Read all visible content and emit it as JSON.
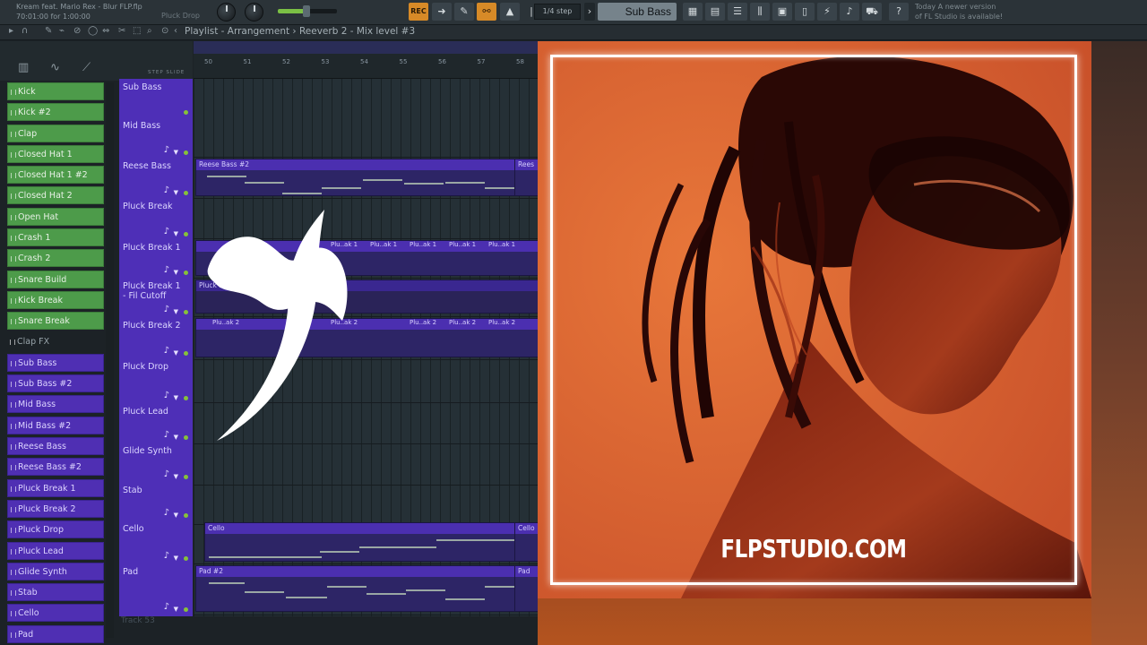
{
  "header": {
    "song_title": "Kream feat. Mario Rex - Blur FLP.flp",
    "song_time": "70:01:00 for 1:00:00",
    "pattern_hint": "Pluck Drop",
    "record_label": "REC",
    "step_size": "1/4 step",
    "selected_channel": "Sub Bass",
    "update_line1": "Today  A newer version",
    "update_line2": "of FL Studio is available!"
  },
  "playlist": {
    "title": "Playlist - Arrangement  ›  Reeverb 2 - Mix level #3",
    "step_slide": "STEP  SLIDE",
    "bars": [
      "50",
      "51",
      "52",
      "53",
      "54",
      "55",
      "56",
      "57",
      "58"
    ],
    "track_footer": "Track 53"
  },
  "channel_rack": [
    {
      "label": "Kick",
      "color": "green"
    },
    {
      "label": "Kick #2",
      "color": "green"
    },
    {
      "label": "Clap",
      "color": "green"
    },
    {
      "label": "Closed Hat 1",
      "color": "green"
    },
    {
      "label": "Closed Hat 1 #2",
      "color": "green"
    },
    {
      "label": "Closed Hat 2",
      "color": "green"
    },
    {
      "label": "Open Hat",
      "color": "green"
    },
    {
      "label": "Crash 1",
      "color": "green"
    },
    {
      "label": "Crash 2",
      "color": "green"
    },
    {
      "label": "Snare Build",
      "color": "green"
    },
    {
      "label": "Kick Break",
      "color": "green"
    },
    {
      "label": "Snare Break",
      "color": "green"
    },
    {
      "label": "Clap FX",
      "color": "none"
    },
    {
      "label": "Sub Bass",
      "color": "purple"
    },
    {
      "label": "Sub Bass #2",
      "color": "purple"
    },
    {
      "label": "Mid Bass",
      "color": "purple"
    },
    {
      "label": "Mid Bass #2",
      "color": "purple"
    },
    {
      "label": "Reese Bass",
      "color": "purple"
    },
    {
      "label": "Reese Bass #2",
      "color": "purple"
    },
    {
      "label": "Pluck Break 1",
      "color": "purple"
    },
    {
      "label": "Pluck Break 2",
      "color": "purple"
    },
    {
      "label": "Pluck Drop",
      "color": "purple"
    },
    {
      "label": "Pluck Lead",
      "color": "purple"
    },
    {
      "label": "Glide Synth",
      "color": "purple"
    },
    {
      "label": "Stab",
      "color": "purple"
    },
    {
      "label": "Cello",
      "color": "purple"
    },
    {
      "label": "Pad",
      "color": "purple"
    }
  ],
  "tracks": [
    {
      "label": "Sub Bass"
    },
    {
      "label": "Mid Bass"
    },
    {
      "label": "Reese Bass"
    },
    {
      "label": "Pluck Break"
    },
    {
      "label": "Pluck Break 1"
    },
    {
      "label": "Pluck Break 1 - Fil Cutoff"
    },
    {
      "label": "Pluck Break 2"
    },
    {
      "label": "Pluck Drop"
    },
    {
      "label": "Pluck Lead"
    },
    {
      "label": "Glide Synth"
    },
    {
      "label": "Stab"
    },
    {
      "label": "Cello"
    },
    {
      "label": "Pad"
    }
  ],
  "clips": {
    "reese": "Reese Bass #2",
    "reese_tail": "Rees",
    "pluck1_segment": "Plu..ak 1",
    "pluck_cutoff": "Pluck Break",
    "pluck2_segment": "Plu..ak 2",
    "cello": "Cello",
    "cello_tail": "Cello",
    "pad": "Pad #2",
    "pad_tail": "Pad"
  },
  "artwork": {
    "site_label": "FLPSTUDIO.COM",
    "background_color": "#e0692f",
    "frame_color": "#ffffff"
  },
  "colors": {
    "green_channel": "#4d9b4a",
    "purple_channel": "#4f2fb3",
    "accent_orange": "#d78a27"
  }
}
